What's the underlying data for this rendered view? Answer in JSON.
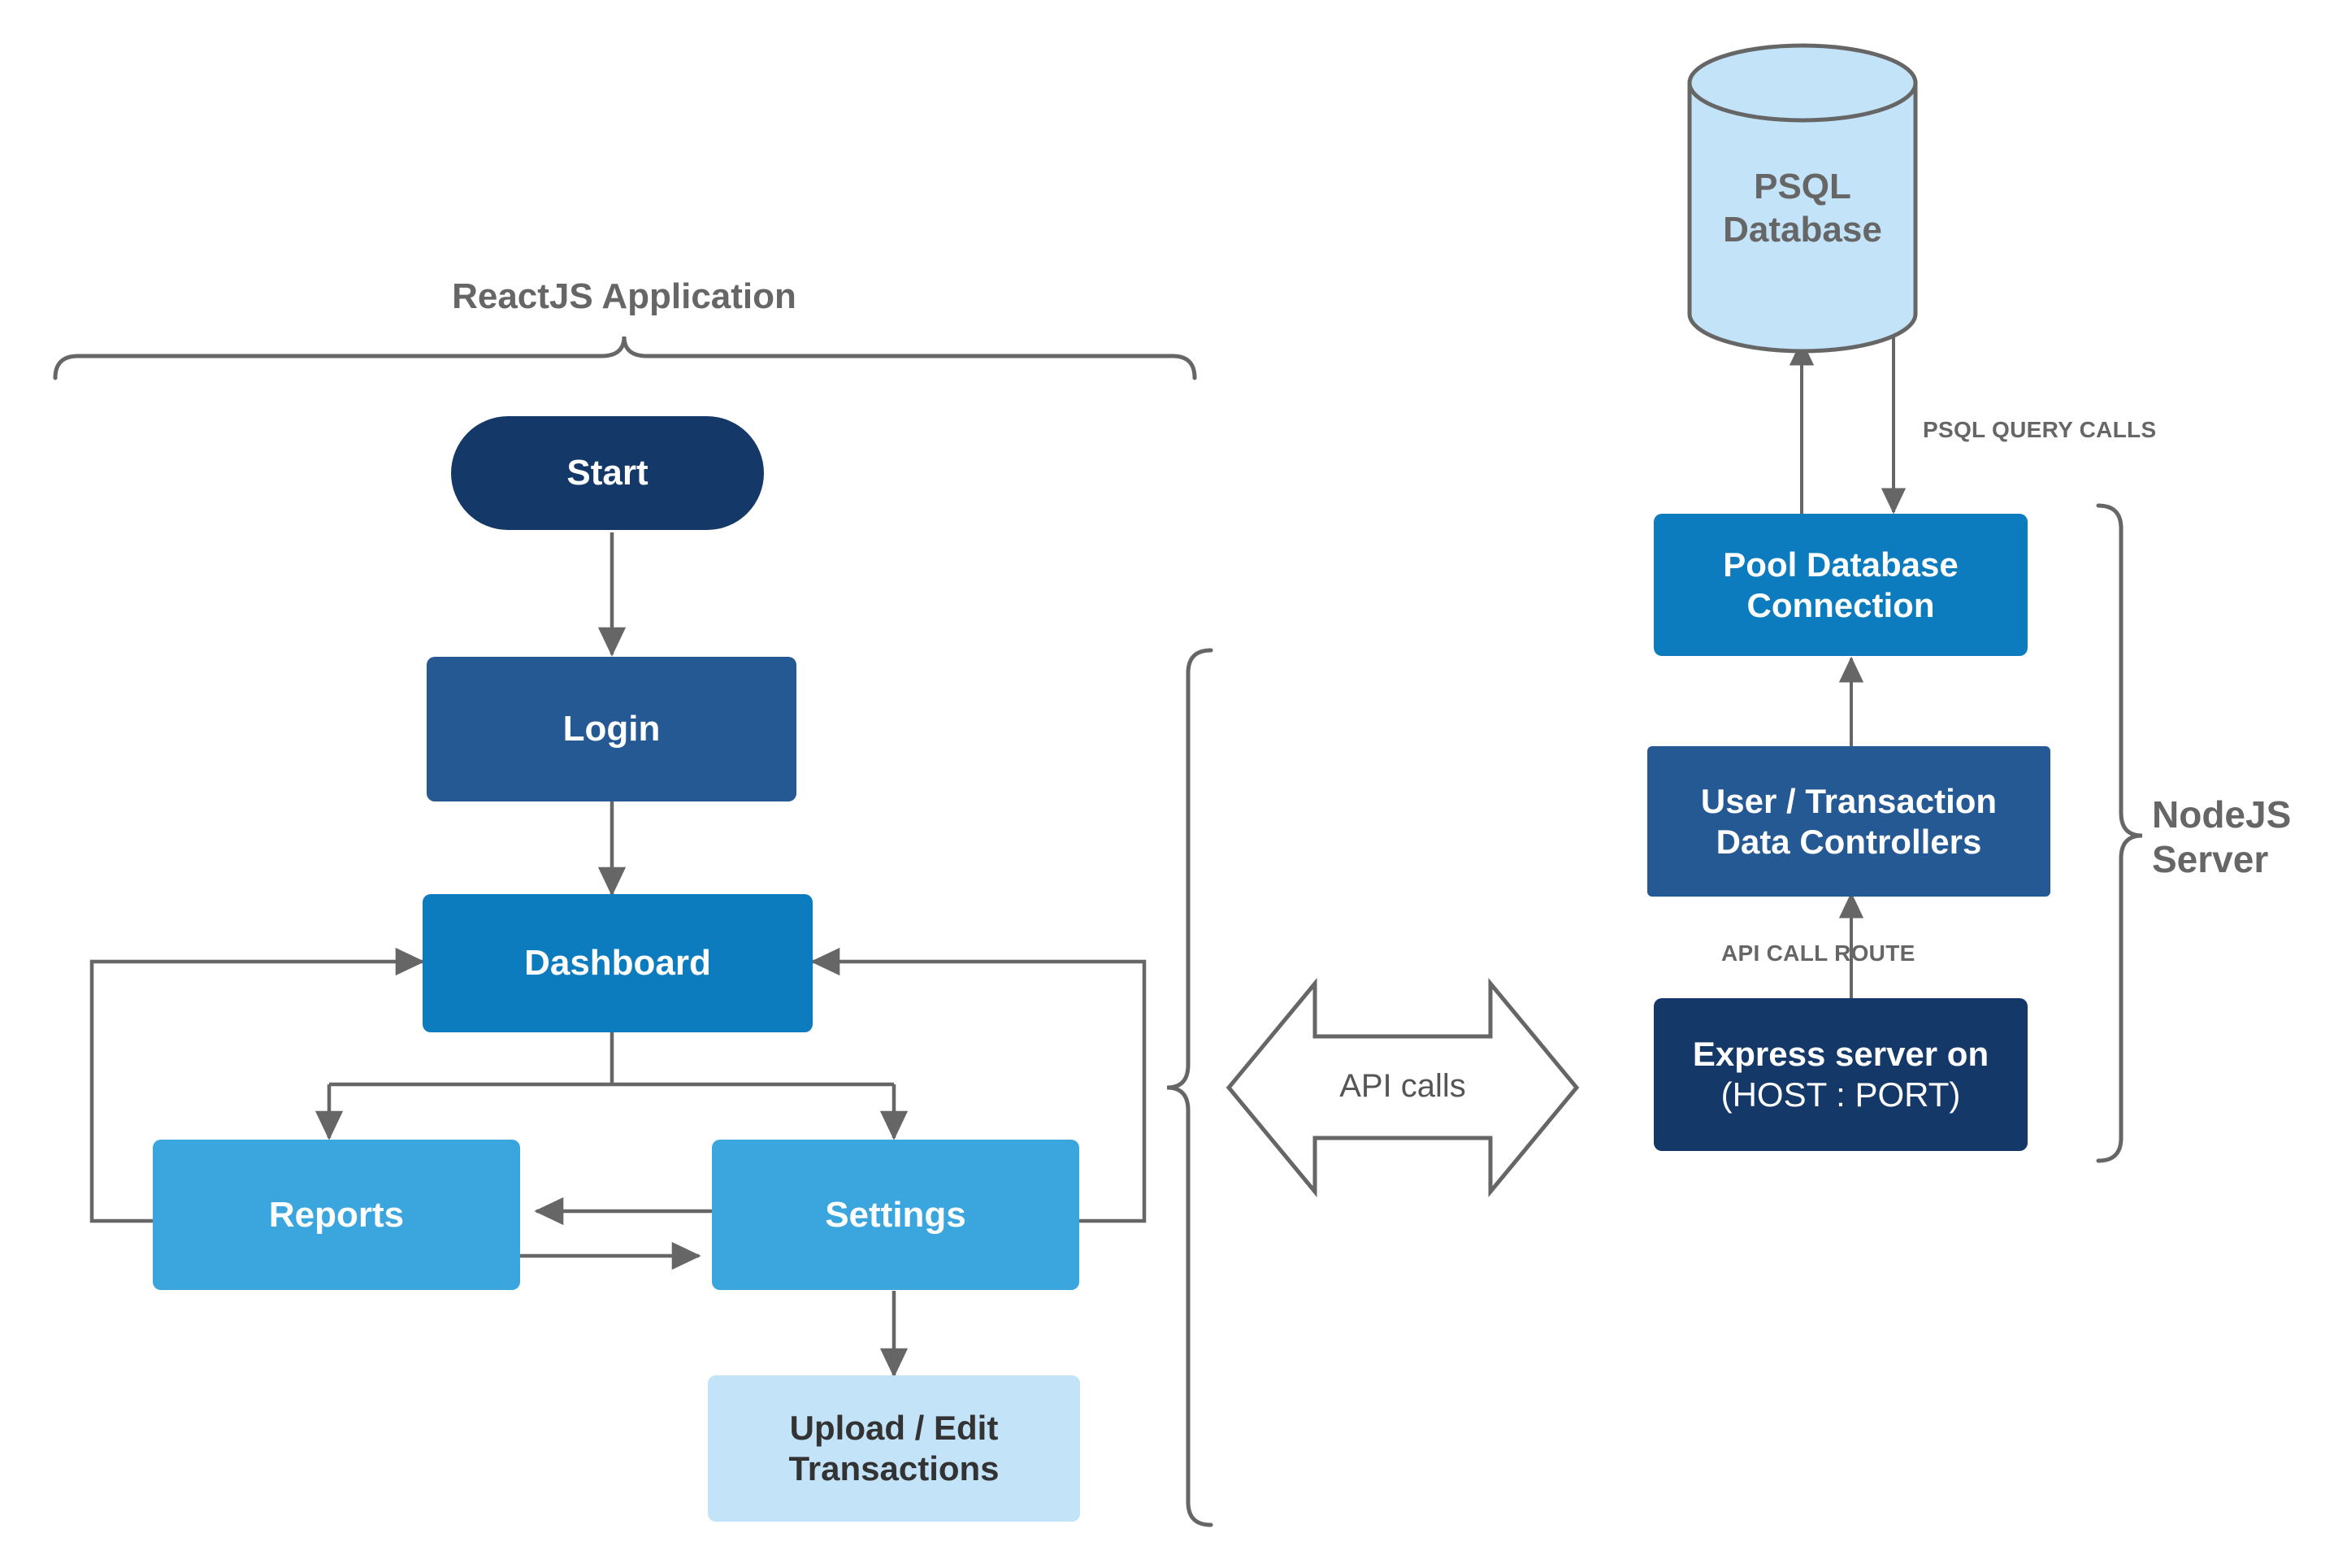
{
  "diagram": {
    "title": "ReactJS application / NodeJS server architecture",
    "colors": {
      "navy_dark": "#143968",
      "navy": "#255994",
      "blue": "#0d7cbe",
      "blue_light": "#3ba5de",
      "blue_pale": "#c3e3f8",
      "gray_stroke": "#666666",
      "text_gray": "#666666",
      "text_dark": "#333333",
      "white": "#ffffff"
    },
    "groups": {
      "client": {
        "label": "ReactJS Application"
      },
      "server": {
        "label": "NodeJS\nServer"
      }
    },
    "nodes": {
      "start": {
        "label": "Start",
        "shape": "pill",
        "fill": "#143968"
      },
      "login": {
        "label": "Login",
        "shape": "rect",
        "fill": "#255994"
      },
      "dashboard": {
        "label": "Dashboard",
        "shape": "rect",
        "fill": "#0d7cbe"
      },
      "reports": {
        "label": "Reports",
        "shape": "rect",
        "fill": "#3ba5de"
      },
      "settings": {
        "label": "Settings",
        "shape": "rect",
        "fill": "#3ba5de"
      },
      "upload": {
        "line1": "Upload / Edit",
        "line2": "Transactions",
        "shape": "rect",
        "fill": "#c3e3f8"
      },
      "database": {
        "line1": "PSQL",
        "line2": "Database",
        "shape": "cylinder",
        "fill": "#c3e3f8"
      },
      "pool": {
        "line1": "Pool Database",
        "line2": "Connection",
        "shape": "rect",
        "fill": "#0d7cbe"
      },
      "controllers": {
        "line1": "User / Transaction",
        "line2": "Data Controllers",
        "shape": "rect",
        "fill": "#255994"
      },
      "express": {
        "line1": "Express server on",
        "line2": "(HOST : PORT)",
        "shape": "rect",
        "fill": "#143968"
      }
    },
    "edge_labels": {
      "psql_query_calls": "PSQL QUERY CALLS",
      "api_call_route": "API CALL ROUTE",
      "api_calls": "API calls"
    }
  }
}
